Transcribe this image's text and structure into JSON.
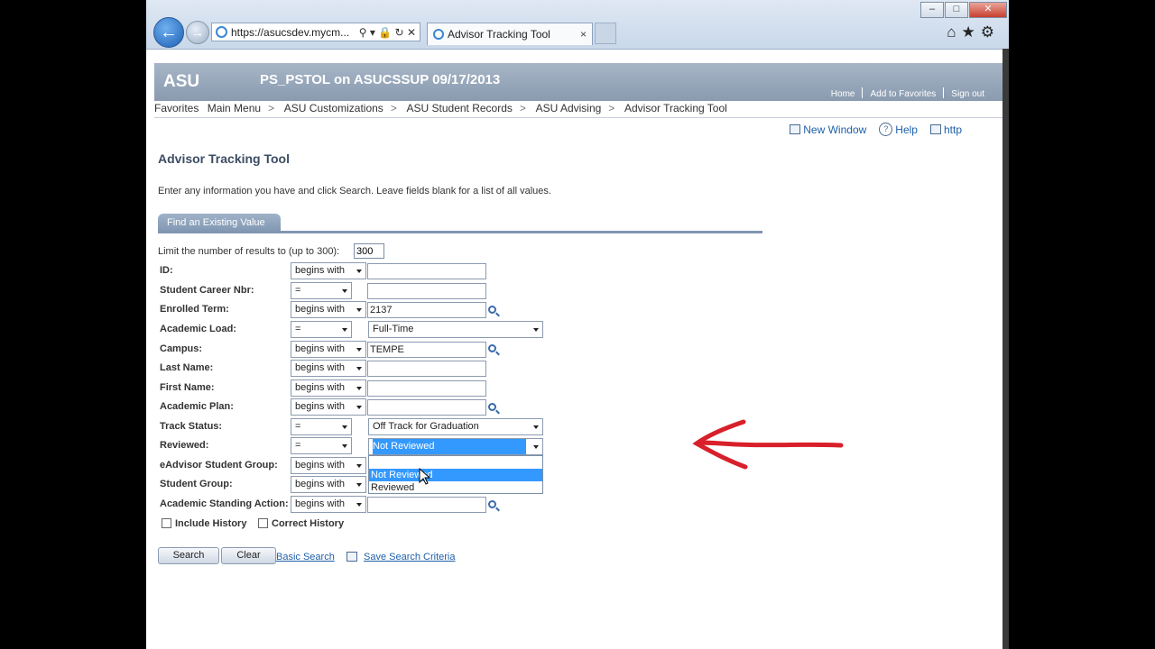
{
  "browser": {
    "address": "https://asucsdev.mycm...",
    "tab_title": "Advisor Tracking Tool",
    "tab_close": "×",
    "minimize": "–",
    "maximize": "□",
    "close": "✕",
    "back": "←",
    "forward": "→",
    "addr_tools": "⚲ ▾ 🔒 ↻ ✕",
    "toolbar_icons": "⌂★⚙"
  },
  "header": {
    "logo": "ASU",
    "title": "PS_PSTOL on ASUCSSUP 09/17/2013",
    "links": [
      "Home",
      "Add to Favorites",
      "Sign out"
    ]
  },
  "breadcrumb": [
    "Favorites",
    "Main Menu",
    "ASU Customizations",
    "ASU Student Records",
    "ASU Advising",
    "Advisor Tracking Tool"
  ],
  "breadcrumb_sep": ">",
  "toplinks": {
    "new_window": "New Window",
    "help": "Help",
    "http": "http",
    "help_glyph": "?"
  },
  "page": {
    "title": "Advisor Tracking Tool",
    "instructions": "Enter any information you have and click Search. Leave fields blank for a list of all values.",
    "tab": "Find an Existing Value",
    "limit_label": "Limit the number of results to (up to 300):",
    "limit_value": "300"
  },
  "fields": [
    {
      "label": "ID:",
      "op": "begins with",
      "value": ""
    },
    {
      "label": "Student Career Nbr:",
      "op": "=",
      "value": ""
    },
    {
      "label": "Enrolled Term:",
      "op": "begins with",
      "value": "2137"
    },
    {
      "label": "Academic Load:",
      "op": "=",
      "value": "Full-Time"
    },
    {
      "label": "Campus:",
      "op": "begins with",
      "value": "TEMPE"
    },
    {
      "label": "Last Name:",
      "op": "begins with",
      "value": ""
    },
    {
      "label": "First Name:",
      "op": "begins with",
      "value": ""
    },
    {
      "label": "Academic Plan:",
      "op": "begins with",
      "value": ""
    },
    {
      "label": "Track Status:",
      "op": "=",
      "value": "Off Track for Graduation"
    },
    {
      "label": "Reviewed:",
      "op": "=",
      "value": "Not Reviewed"
    },
    {
      "label": "eAdvisor Student Group:",
      "op": "begins with",
      "value": ""
    },
    {
      "label": "Student Group:",
      "op": "begins with",
      "value": ""
    },
    {
      "label": "Academic Standing Action:",
      "op": "begins with",
      "value": ""
    }
  ],
  "dropdown": {
    "options": [
      "",
      "Not Reviewed",
      "Reviewed"
    ],
    "highlighted": "Not Reviewed"
  },
  "checkboxes": {
    "include_history": "Include History",
    "correct_history": "Correct History"
  },
  "buttons": {
    "search": "Search",
    "clear": "Clear"
  },
  "links": {
    "basic_search": "Basic Search",
    "save_search": "Save Search Criteria"
  },
  "colors": {
    "header": "#8a9bb0",
    "link": "#1d5fa9",
    "arrow": "#d8202a",
    "selection": "#3399ff"
  }
}
